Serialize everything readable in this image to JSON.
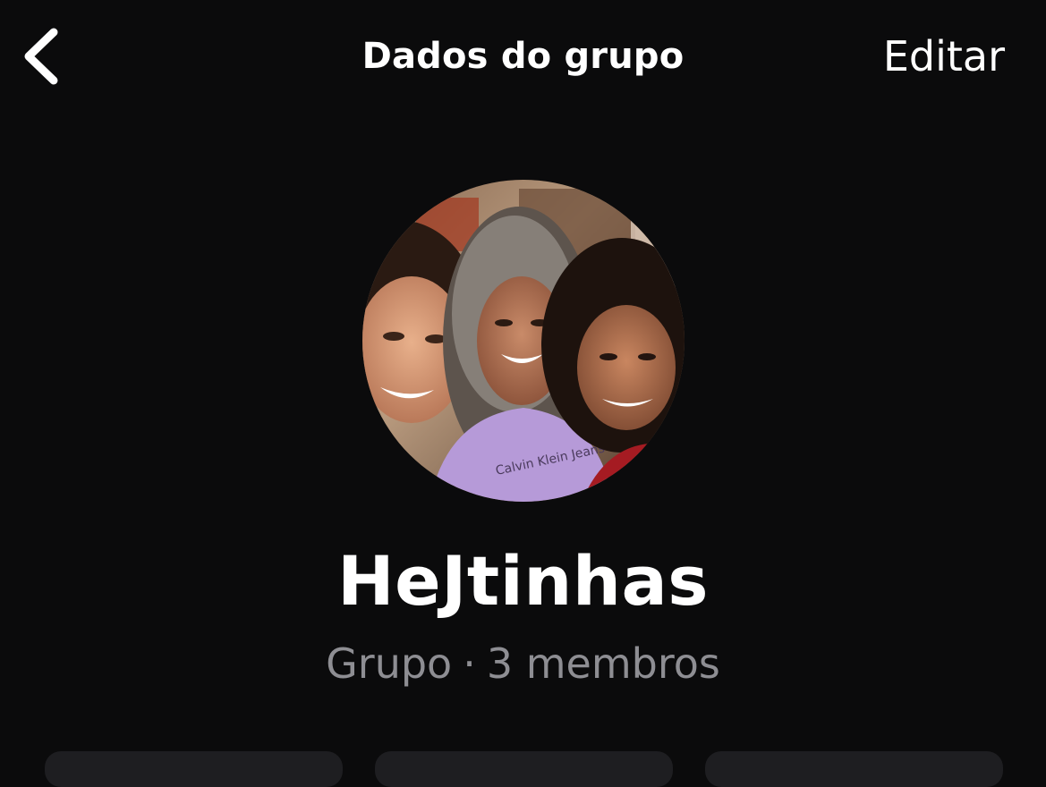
{
  "header": {
    "title": "Dados do grupo",
    "back_icon": "chevron-left-icon",
    "edit_label": "Editar"
  },
  "group": {
    "name": "HeJtinhas",
    "type_label": "Grupo",
    "separator": "·",
    "members_label": "3 membros",
    "avatar_icon": "group-photo"
  },
  "actions": [
    {
      "name": "action-1"
    },
    {
      "name": "action-2"
    },
    {
      "name": "action-3"
    }
  ],
  "colors": {
    "background": "#0b0b0c",
    "text": "#ffffff",
    "secondary_text": "#8e8e93",
    "pill": "#1e1e21"
  }
}
